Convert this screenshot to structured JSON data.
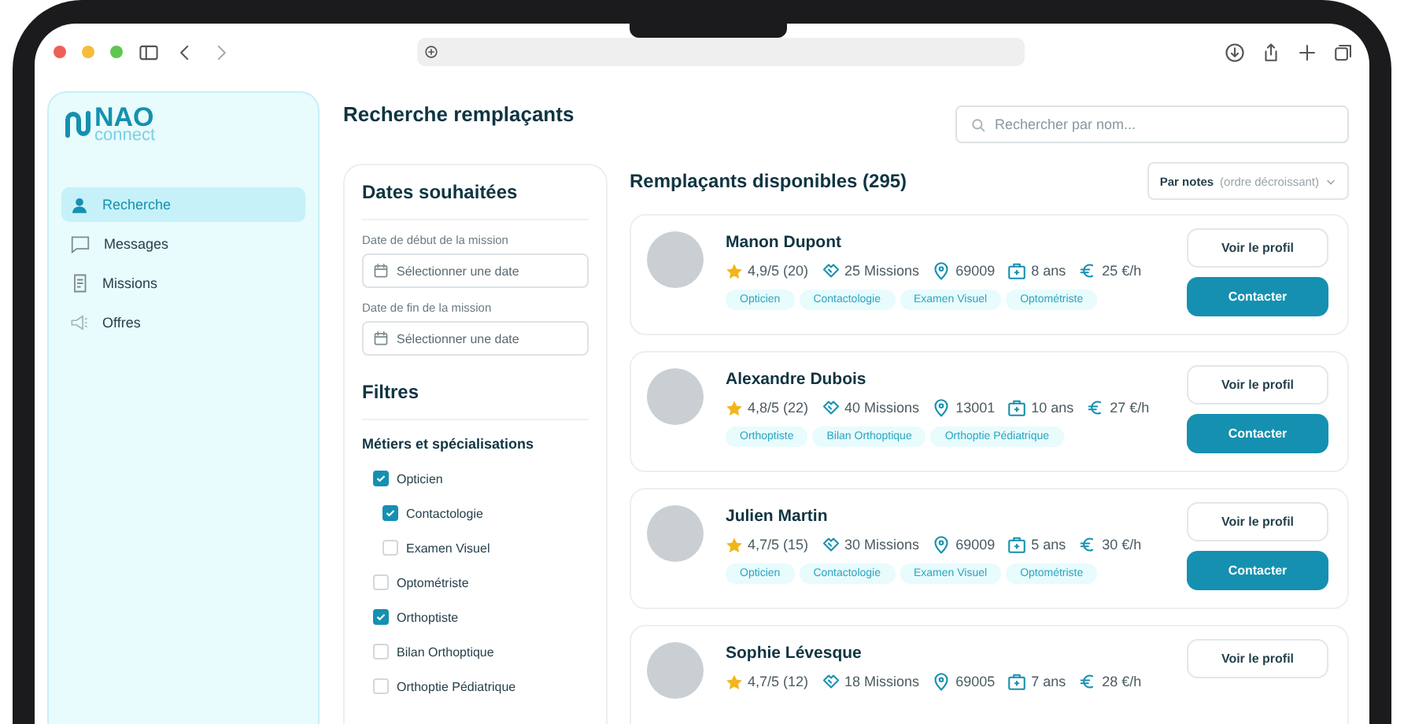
{
  "sidebar": {
    "logo": {
      "name": "NAO",
      "tagline": "connect"
    },
    "items": [
      {
        "label": "Recherche",
        "kind": "person",
        "selected": true
      },
      {
        "label": "Messages",
        "kind": "chat",
        "selected": false
      },
      {
        "label": "Missions",
        "kind": "document",
        "selected": false
      },
      {
        "label": "Offres",
        "kind": "megaphone",
        "selected": false
      }
    ]
  },
  "page_title": "Recherche remplaçants",
  "search": {
    "placeholder": "Rechercher par nom..."
  },
  "filters": {
    "dates_title": "Dates souhaitées",
    "date_fields": [
      {
        "label": "Date de début de la mission",
        "placeholder": "Sélectionner une date"
      },
      {
        "label": "Date de fin de la mission",
        "placeholder": "Sélectionner une date"
      }
    ],
    "filters_title": "Filtres",
    "group_title": "Métiers et spécialisations",
    "options": [
      {
        "label": "Opticien",
        "checked": true,
        "children": [
          {
            "label": "Contactologie",
            "checked": true
          },
          {
            "label": "Examen Visuel",
            "checked": false
          }
        ]
      },
      {
        "label": "Optométriste",
        "checked": false
      },
      {
        "label": "Orthoptiste",
        "checked": true
      },
      {
        "label": "Bilan Orthoptique",
        "checked": false
      },
      {
        "label": "Orthoptie Pédiatrique",
        "checked": false
      }
    ]
  },
  "results": {
    "title": "Remplaçants disponibles (295)",
    "sort": {
      "label": "Par notes",
      "detail": "(ordre décroissant)"
    },
    "candidates": [
      {
        "name": "Manon Dupont",
        "rating": "4,9/5 (20)",
        "missions": "25 Missions",
        "zip": "69009",
        "experience": "8 ans",
        "rate": "25 €/h",
        "tags": [
          "Opticien",
          "Contactologie",
          "Examen Visuel",
          "Optométriste"
        ],
        "buttons": [
          "Voir le profil",
          "Contacter"
        ]
      },
      {
        "name": "Alexandre Dubois",
        "rating": "4,8/5 (22)",
        "missions": "40 Missions",
        "zip": "13001",
        "experience": "10 ans",
        "rate": "27 €/h",
        "tags": [
          "Orthoptiste",
          "Bilan Orthoptique",
          "Orthoptie Pédiatrique"
        ],
        "buttons": [
          "Voir le profil",
          "Contacter"
        ]
      },
      {
        "name": "Julien Martin",
        "rating": "4,7/5 (15)",
        "missions": "30 Missions",
        "zip": "69009",
        "experience": "5 ans",
        "rate": "30 €/h",
        "tags": [
          "Opticien",
          "Contactologie",
          "Examen Visuel",
          "Optométriste"
        ],
        "buttons": [
          "Voir le profil",
          "Contacter"
        ]
      },
      {
        "name": "Sophie Lévesque",
        "rating": "4,7/5 (12)",
        "missions": "18 Missions",
        "zip": "69005",
        "experience": "7 ans",
        "rate": "28 €/h",
        "buttons": [
          "Voir le profil"
        ]
      }
    ]
  }
}
